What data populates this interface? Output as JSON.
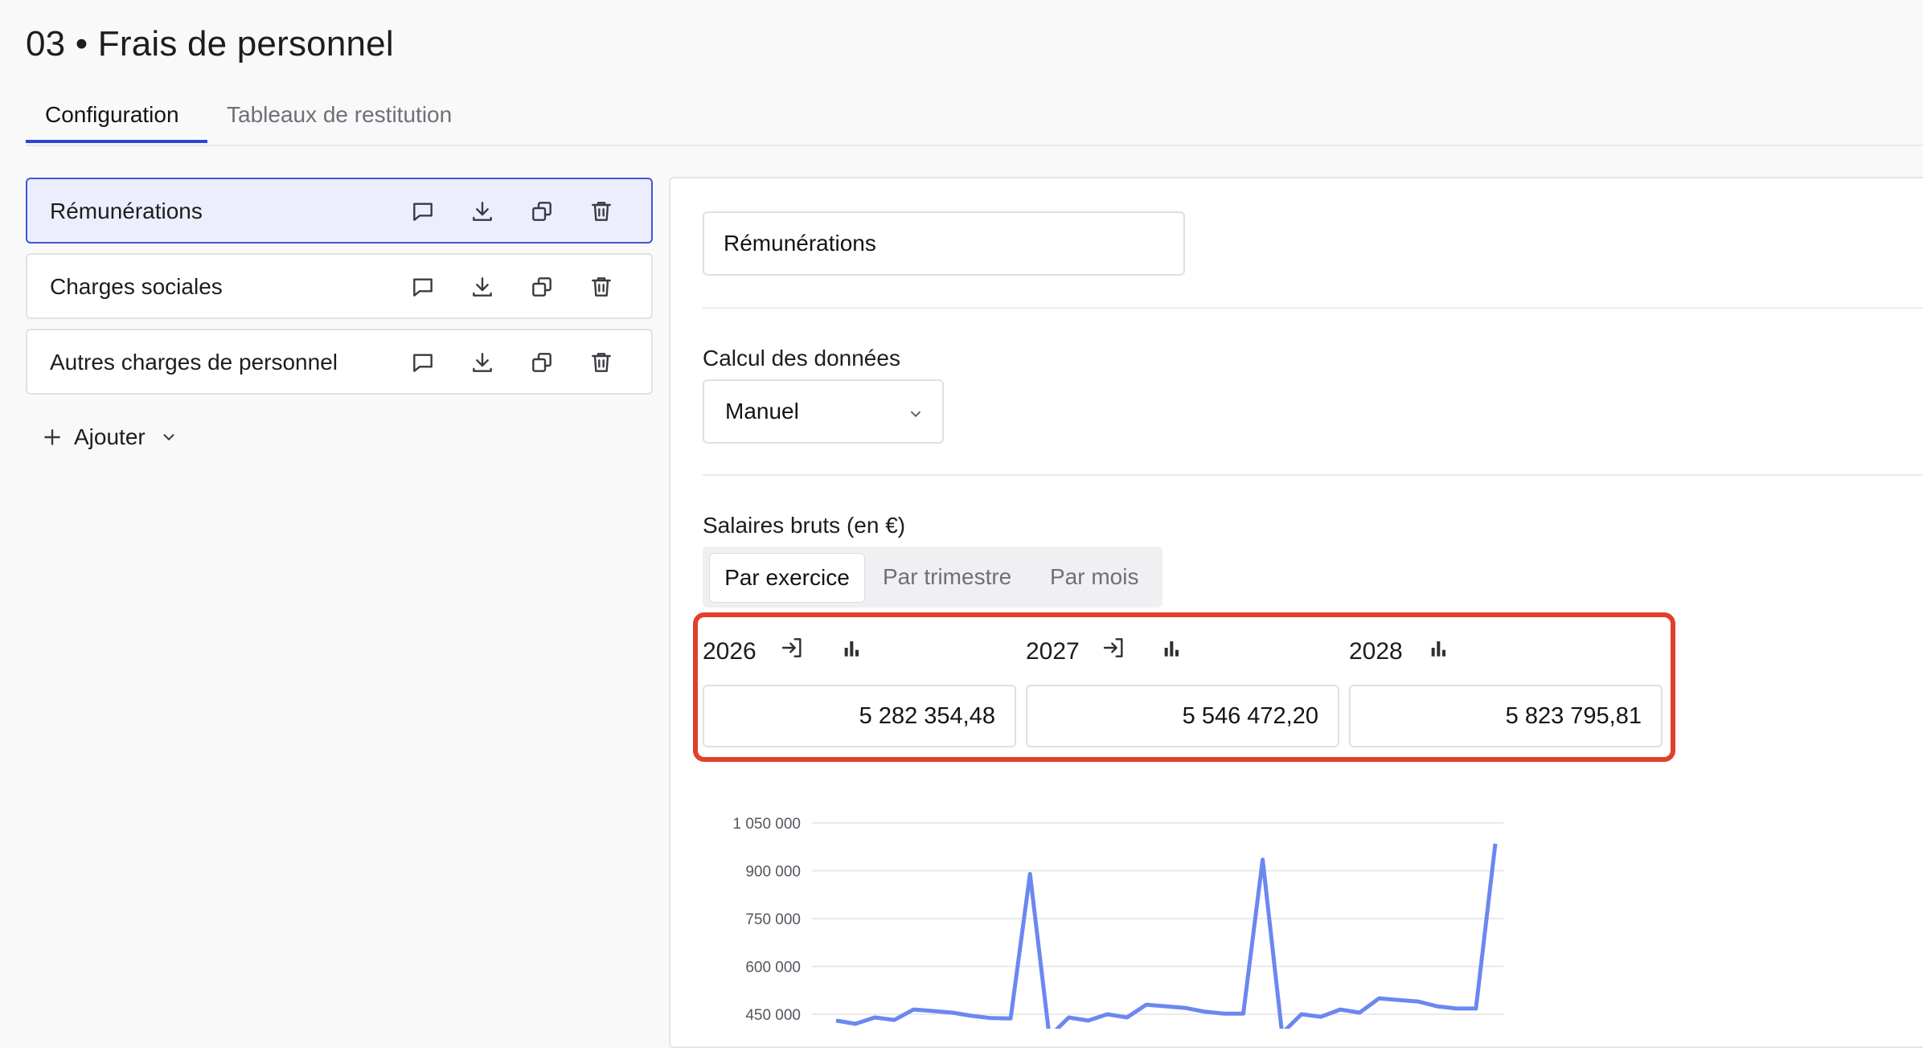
{
  "page": {
    "title": "03 • Frais de personnel"
  },
  "tabs": [
    {
      "label": "Configuration",
      "active": true
    },
    {
      "label": "Tableaux de restitution",
      "active": false
    }
  ],
  "sidebar": {
    "items": [
      {
        "label": "Rémunérations",
        "selected": true
      },
      {
        "label": "Charges sociales",
        "selected": false
      },
      {
        "label": "Autres charges de personnel",
        "selected": false
      }
    ],
    "item_actions": [
      "comment-icon",
      "download-icon",
      "duplicate-icon",
      "delete-icon"
    ],
    "add_label": "Ajouter"
  },
  "detail": {
    "name_value": "Rémunérations",
    "calc_label": "Calcul des données",
    "calc_value": "Manuel",
    "salary_label": "Salaires bruts (en €)",
    "period_tabs": [
      "Par exercice",
      "Par trimestre",
      "Par mois"
    ],
    "years": [
      {
        "year": "2026",
        "value": "5 282 354,48",
        "icons": [
          "import-icon",
          "bar-chart-icon"
        ]
      },
      {
        "year": "2027",
        "value": "5 546 472,20",
        "icons": [
          "import-icon",
          "bar-chart-icon"
        ]
      },
      {
        "year": "2028",
        "value": "5 823 795,81",
        "icons": [
          "bar-chart-icon"
        ]
      }
    ],
    "highlight_color": "#e2402a"
  },
  "chart_data": {
    "type": "line",
    "yticks": [
      "1 050 000",
      "900 000",
      "750 000",
      "600 000",
      "450 000"
    ],
    "ylim": [
      450000,
      1050000
    ],
    "grid": true,
    "series": [
      {
        "color": "#6b87f0",
        "values": [
          430000,
          420000,
          440000,
          432000,
          465000,
          460000,
          455000,
          445000,
          438000,
          437000,
          890000,
          380000,
          440000,
          430000,
          450000,
          440000,
          480000,
          475000,
          470000,
          458000,
          452000,
          452000,
          935000,
          390000,
          450000,
          442000,
          465000,
          455000,
          500000,
          495000,
          490000,
          475000,
          468000,
          468000,
          985000
        ]
      }
    ]
  },
  "colors": {
    "accent": "#2b46d6",
    "selected_bg": "#eceefe"
  }
}
